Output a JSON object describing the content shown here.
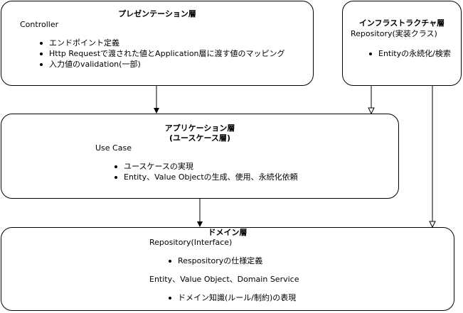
{
  "presentation": {
    "title": "プレゼンテーション層",
    "subtitle": "Controller",
    "bullets": [
      "エンドポイント定義",
      "Http Requestで渡された値とApplication層に渡す値のマッピング",
      "入力値のvalidation(一部)"
    ]
  },
  "infrastructure": {
    "title": "インフラストラクチャ層",
    "subtitle": "Repository(実装クラス)",
    "bullets": [
      "Entityの永続化/検索"
    ]
  },
  "application": {
    "title_line1": "アプリケーション層",
    "title_line2": "(ユースケース層)",
    "subtitle": "Use Case",
    "bullets": [
      "ユースケースの実現",
      "Entity、Value Objectの生成、使用、永続化依頼"
    ]
  },
  "domain": {
    "title": "ドメイン層",
    "subtitle1": "Repository(Interface)",
    "bullets1": [
      "Respositoryの仕様定義"
    ],
    "subtitle2": "Entity、Value Object、Domain Service",
    "bullets2": [
      "ドメイン知識(ルール/制約)の表現"
    ]
  },
  "colors": {
    "stroke": "#000000",
    "fill": "#ffffff"
  }
}
